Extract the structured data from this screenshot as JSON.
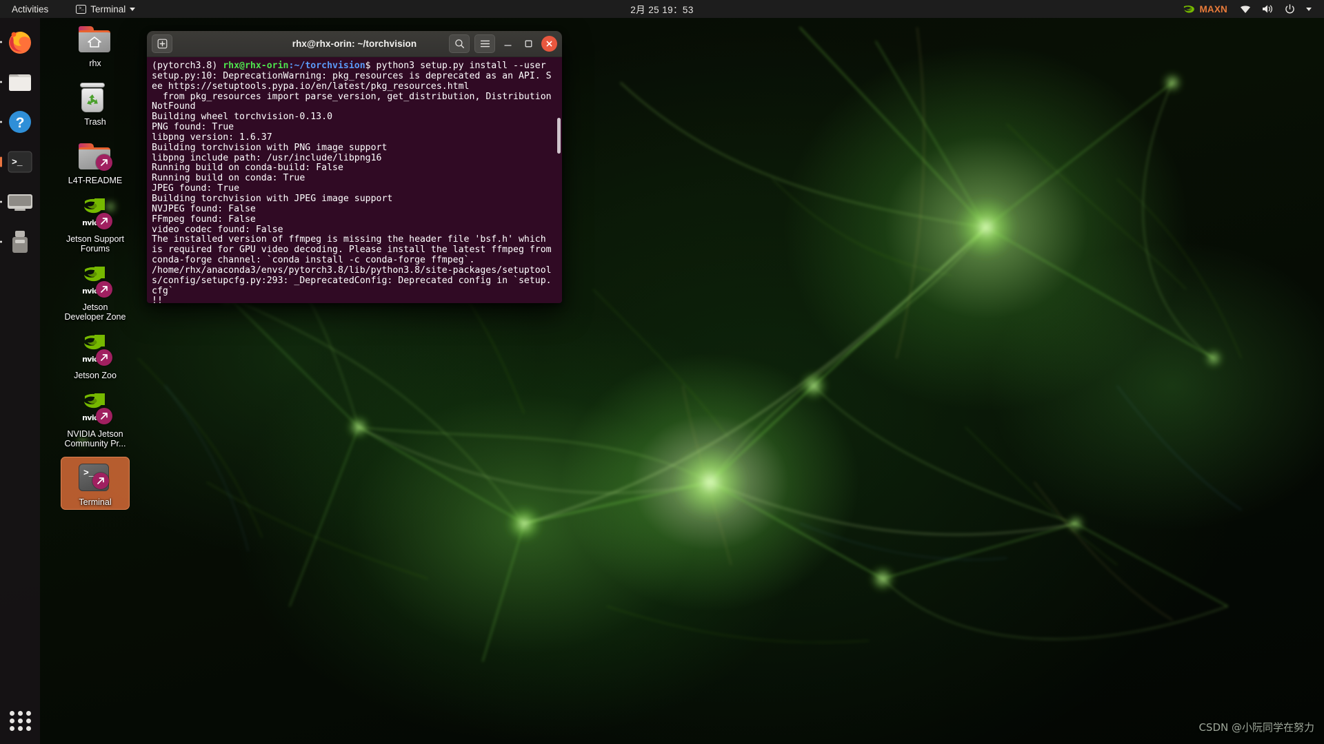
{
  "topbar": {
    "activities": "Activities",
    "app_menu": "Terminal",
    "app_menu_icon": "terminal-icon",
    "clock": "2月 25  19：53",
    "power_mode": "MAXN",
    "nvidia_icon": "nvidia-logo-icon",
    "wifi_icon": "wifi-icon",
    "volume_icon": "volume-icon",
    "power_icon": "power-icon",
    "caret_icon": "chevron-down-icon"
  },
  "dock": {
    "items": [
      {
        "name": "firefox",
        "label": "Firefox",
        "running": false
      },
      {
        "name": "files",
        "label": "Files",
        "running": false
      },
      {
        "name": "help",
        "label": "Help",
        "running": false
      },
      {
        "name": "terminal",
        "label": "Terminal",
        "running": true
      },
      {
        "name": "software",
        "label": "Ubuntu Software",
        "running": false
      },
      {
        "name": "usb-drive",
        "label": "USB Drive",
        "running": false
      }
    ],
    "show_apps_label": "Show Applications"
  },
  "desktop_icons": [
    {
      "label": "rhx",
      "type": "folder-home",
      "link": false,
      "selected": false
    },
    {
      "label": "Trash",
      "type": "trash",
      "link": false,
      "selected": false
    },
    {
      "label": "L4T-README",
      "type": "folder",
      "link": true,
      "selected": false
    },
    {
      "label": "Jetson Support Forums",
      "type": "nvidia",
      "link": true,
      "selected": false
    },
    {
      "label": "Jetson Developer Zone",
      "type": "nvidia",
      "link": true,
      "selected": false
    },
    {
      "label": "Jetson Zoo",
      "type": "nvidia",
      "link": true,
      "selected": false
    },
    {
      "label": "NVIDIA Jetson Community Pr...",
      "type": "nvidia",
      "link": true,
      "selected": false
    },
    {
      "label": "Terminal",
      "type": "terminal",
      "link": true,
      "selected": true
    }
  ],
  "terminal": {
    "title": "rhx@rhx-orin: ~/torchvision",
    "new_tab_icon": "new-tab-icon",
    "search_icon": "search-icon",
    "menu_icon": "hamburger-menu-icon",
    "minimize_icon": "minimize-icon",
    "maximize_icon": "maximize-icon",
    "close_icon": "close-icon",
    "background_color": "#300a24",
    "prompt": {
      "env": "(pytorch3.8) ",
      "user_host": "rhx@rhx-orin",
      "path": ":~/torchvision",
      "symbol": "$ ",
      "command": "python3 setup.py install --user"
    },
    "output": "setup.py:10: DeprecationWarning: pkg_resources is deprecated as an API. See https://setuptools.pypa.io/en/latest/pkg_resources.html\n  from pkg_resources import parse_version, get_distribution, DistributionNotFound\nBuilding wheel torchvision-0.13.0\nPNG found: True\nlibpng version: 1.6.37\nBuilding torchvision with PNG image support\nlibpng include path: /usr/include/libpng16\nRunning build on conda-build: False\nRunning build on conda: True\nJPEG found: True\nBuilding torchvision with JPEG image support\nNVJPEG found: False\nFFmpeg found: False\nvideo codec found: False\nThe installed version of ffmpeg is missing the header file 'bsf.h' which is required for GPU video decoding. Please install the latest ffmpeg from conda-forge channel: `conda install -c conda-forge ffmpeg`.\n/home/rhx/anaconda3/envs/pytorch3.8/lib/python3.8/site-packages/setuptools/config/setupcfg.py:293: _DeprecatedConfig: Deprecated config in `setup.cfg`\n!!"
  },
  "watermark": "CSDN @小阮同学在努力",
  "colors": {
    "terminal_bg": "#300a24",
    "accent_orange": "#e8622f",
    "nvidia_green": "#76b900",
    "close_red": "#e8573f",
    "topbar_bg": "#1d1d1d"
  }
}
